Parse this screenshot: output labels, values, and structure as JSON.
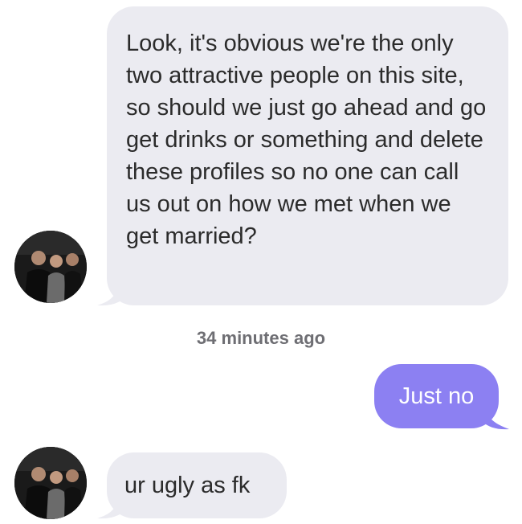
{
  "conversation": {
    "messages": [
      {
        "direction": "incoming",
        "text": "Look, it's obvious we're the only two attractive people on this site, so should we just go ahead and go get drinks or something and delete these profiles so no one can call us out on how we met when we get married?"
      },
      {
        "direction": "outgoing",
        "text": "Just no"
      },
      {
        "direction": "incoming",
        "text": "ur ugly as fk"
      }
    ],
    "timestamp": "34 minutes ago"
  },
  "colors": {
    "incoming_bubble": "#ebebf1",
    "outgoing_bubble": "#8c80f2",
    "timestamp_text": "#6e6e73"
  }
}
